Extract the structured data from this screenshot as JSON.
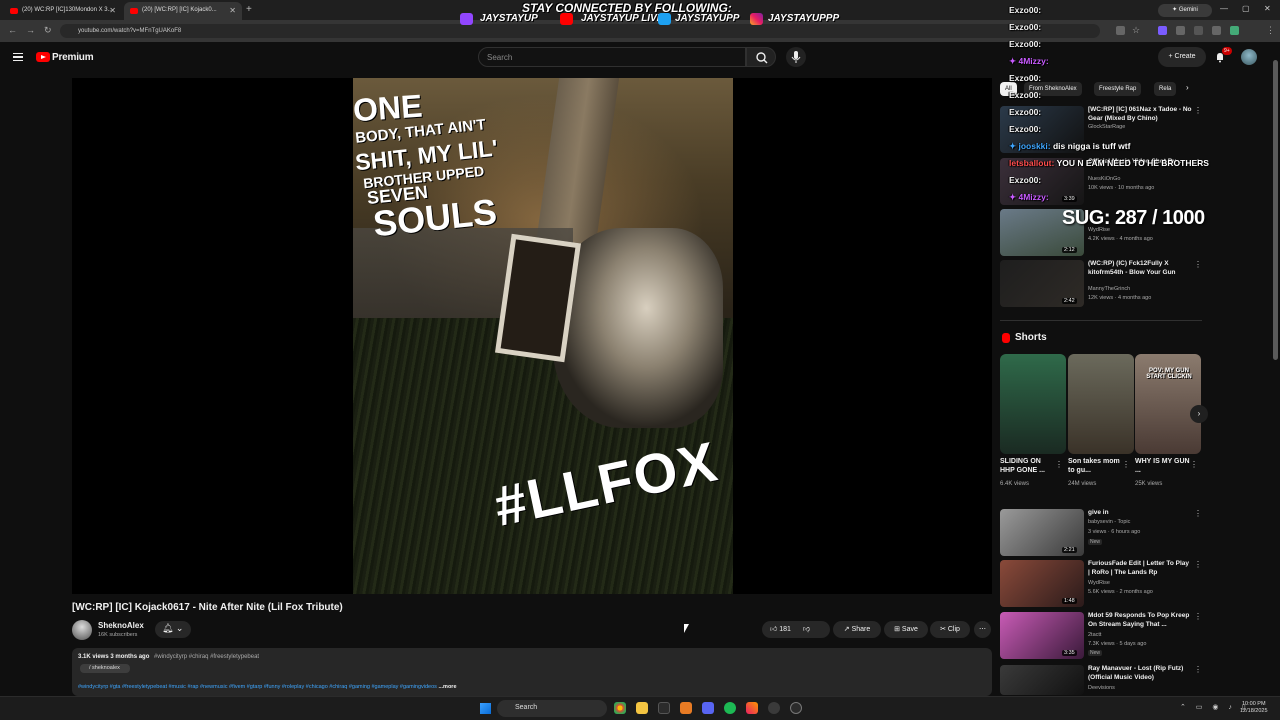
{
  "browser": {
    "tabs": [
      {
        "label": "(20) WC:RP [IC]130Mondon X 3..."
      },
      {
        "label": "(20) [WC:RP] [IC] Kojack0..."
      }
    ],
    "gemini_label": "Gemini",
    "url": "youtube.com/watch?v=MFnTgUAKoF8"
  },
  "header": {
    "logo_text": "Premium",
    "search_placeholder": "Search",
    "create_label": "Create",
    "notification_count": "9+"
  },
  "overlay": {
    "banner": "STAY CONNECTED BY FOLLOWING:",
    "socials": [
      {
        "name": "JAYSTAYUP",
        "icon": "twitch-icon"
      },
      {
        "name": "JAYSTAYUP LIVE",
        "icon": "youtube-icon"
      },
      {
        "name": "JAYSTAYUPP",
        "icon": "twitter-icon"
      },
      {
        "name": "JAYSTAYUPPP",
        "icon": "instagram-icon"
      }
    ],
    "chat": [
      {
        "user": "Exzo00:",
        "msg": "",
        "color": "#ffffff"
      },
      {
        "user": "Exzo00:",
        "msg": "",
        "color": "#ffffff"
      },
      {
        "user": "Exzo00:",
        "msg": "",
        "color": "#ffffff"
      },
      {
        "user": "4Mizzy:",
        "msg": "",
        "color": "#c85bff"
      },
      {
        "user": "Exzo00:",
        "msg": "",
        "color": "#ffffff"
      },
      {
        "user": "Exzo00:",
        "msg": "",
        "color": "#ffffff"
      },
      {
        "user": "Exzo00:",
        "msg": "",
        "color": "#ffffff"
      },
      {
        "user": "Exzo00:",
        "msg": "",
        "color": "#ffffff"
      },
      {
        "user": "jooskki:",
        "msg": "dis nigga is tuff wtf",
        "color": "#3ea6ff"
      },
      {
        "user": "letsballout:",
        "msg": "YOU N EAM NEED TO HE BROTHERS",
        "color": "#ff4d4d"
      },
      {
        "user": "Exzo00:",
        "msg": "",
        "color": "#ffffff"
      },
      {
        "user": "4Mizzy:",
        "msg": "",
        "color": "#c85bff"
      }
    ],
    "goal": "SUG: 287 / 1000"
  },
  "video": {
    "captions": [
      "ONE",
      "BODY, THAT AIN'T",
      "SHIT, MY LIL'",
      "BROTHER UPPED",
      "SEVEN",
      "SOULS",
      "#LLFOX"
    ],
    "title": "[WC:RP] [IC] Kojack0617 - Nite After Nite (Lil Fox Tribute)",
    "channel": "SheknoAlex",
    "subscribers": "16K subscribers",
    "likes": "181",
    "share_label": "Share",
    "save_label": "Save",
    "clip_label": "Clip",
    "views": "3.1K views",
    "age": "3 months ago",
    "meta_tags": "#windycityrp #chiraq #freestyletypebeat",
    "desc_channel": "/ sheknoalex",
    "desc_tags": "#windycityrp #gta #freestyletypebeat #music #rap #newmusic #fivem #gtarp #funny #roleplay #chicago #chiraq #gaming #gameplay #gamingvideos",
    "more_label": "...more"
  },
  "chips": [
    "All",
    "From SheknoAlex",
    "Freestyle Rap",
    "Rela"
  ],
  "recommendations": [
    {
      "title": "[WC:RP] [IC] 061Naz x Tadoe - No Gear (Mixed By Chino)",
      "channel": "GlockStarRage",
      "meta": "",
      "duration": "",
      "thumb": "#2b3a4a"
    },
    {
      "title": "Official Music Video Shot By ...",
      "channel": "NuesKiOnGo",
      "meta": "10K views · 10 months ago",
      "duration": "3:39",
      "thumb": "#3b2f3a"
    },
    {
      "title": "",
      "channel": "WydRise",
      "meta": "4.2K views · 4 months ago",
      "duration": "2:12",
      "thumb": "#4a5560"
    },
    {
      "title": "(WC:RP) (IC) Fck12Fully X kitofrm54th - Blow Your Gun",
      "channel": "MannyTheGrinch",
      "meta": "12K views · 4 months ago",
      "duration": "2:42",
      "thumb": "#1e1e1e"
    }
  ],
  "shorts": {
    "title": "Shorts",
    "items": [
      {
        "title": "SLIDING ON HHP GONE ...",
        "views": "6.4K views",
        "thumb": "#2f6a4a",
        "caption": ""
      },
      {
        "title": "Son takes mom to gu...",
        "views": "24M views",
        "thumb": "#6b6a5c",
        "caption": ""
      },
      {
        "title": "WHY IS MY GUN ...",
        "views": "25K views",
        "thumb": "#8b7b6e",
        "caption": "POV: MY GUN START CLICKIN"
      }
    ]
  },
  "recommendations2": [
    {
      "title": "give in",
      "channel": "babysevin - Topic",
      "meta": "3 views · 6 hours ago",
      "badge": "New",
      "duration": "2:21",
      "thumb": "#7a7a7a"
    },
    {
      "title": "FuriousFade Edit | Letter To Play | RoRo | The Lands Rp",
      "channel": "WydRise",
      "meta": "5.6K views · 2 months ago",
      "badge": "",
      "duration": "1:48",
      "thumb": "#8a4a3a"
    },
    {
      "title": "Mdot 59 Responds To Pop Kreep On Stream Saying That ...",
      "channel": "2tactt",
      "meta": "7.3K views · 5 days ago",
      "badge": "New",
      "duration": "3:35",
      "thumb": "#6b3a6b"
    },
    {
      "title": "Ray Manavuer - Lost (Rip Futz) (Official Music Video)",
      "channel": "Deevisions",
      "meta": "",
      "badge": "",
      "duration": "",
      "thumb": "#3a3a3a"
    }
  ],
  "taskbar": {
    "search_label": "Search",
    "time": "10:00 PM",
    "date": "12/18/2025"
  }
}
